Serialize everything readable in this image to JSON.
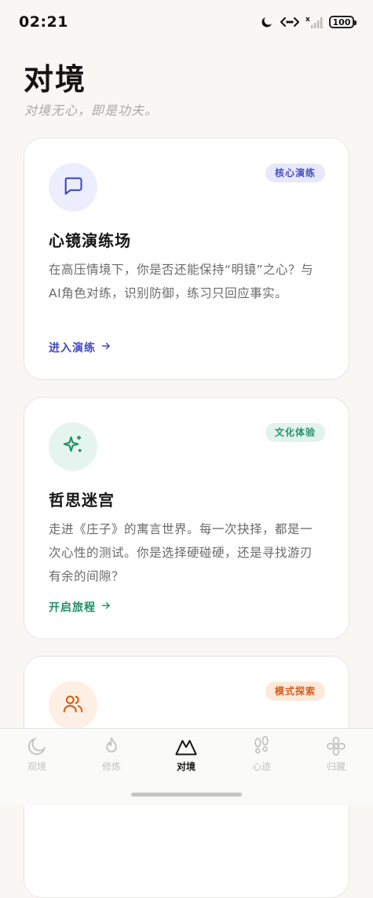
{
  "status": {
    "time": "02:21",
    "battery": "100",
    "icons": [
      "moon-icon",
      "link-arrows-icon",
      "signal-off-icon",
      "battery-icon"
    ]
  },
  "header": {
    "title": "对境",
    "subtitle": "对境无心，即是功夫。"
  },
  "cards": [
    {
      "badge": "核心演练",
      "title": "心镜演练场",
      "description": "在高压情境下，你是否还能保持“明镜”之心？与AI角色对练，识别防御，练习只回应事实。",
      "link": "进入演练",
      "icon": "chat-bubble-icon",
      "accent": "#4347c6"
    },
    {
      "badge": "文化体验",
      "title": "哲思迷宫",
      "description": "走进《庄子》的寓言世界。每一次抉择，都是一次心性的测试。你是选择硬碰硬，还是寻找游刃有余的间隙？",
      "link": "开启旅程",
      "icon": "sparkles-icon",
      "accent": "#1f9167"
    },
    {
      "badge": "模式探索",
      "icon": "users-icon",
      "accent": "#d1601e"
    }
  ],
  "nav": {
    "items": [
      {
        "label": "观境",
        "icon": "moon-icon"
      },
      {
        "label": "修炼",
        "icon": "flame-icon"
      },
      {
        "label": "对境",
        "icon": "mountain-icon",
        "active": true
      },
      {
        "label": "心迹",
        "icon": "footprints-icon"
      },
      {
        "label": "归藏",
        "icon": "flower-icon"
      }
    ]
  }
}
